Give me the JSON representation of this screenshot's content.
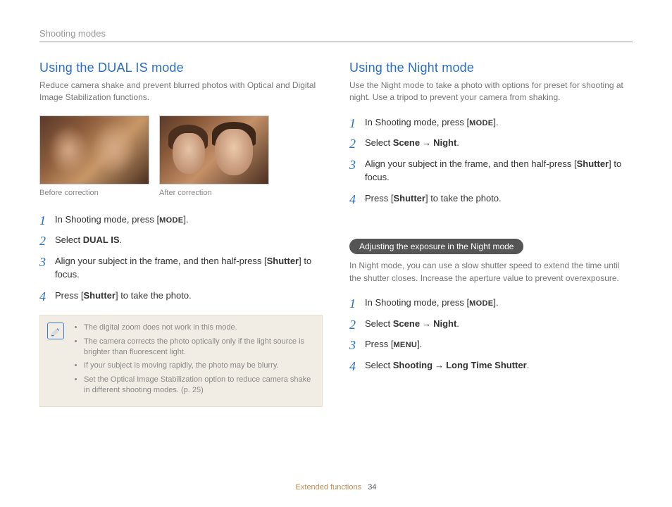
{
  "breadcrumb": "Shooting modes",
  "left": {
    "heading": "Using the DUAL IS mode",
    "intro": "Reduce camera shake and prevent blurred photos with Optical and Digital Image Stabilization functions.",
    "caption_before": "Before correction",
    "caption_after": "After correction",
    "step1_a": "In Shooting mode, press [",
    "step1_mode": "MODE",
    "step1_b": "].",
    "step2_a": "Select ",
    "step2_b": "DUAL IS",
    "step2_c": ".",
    "step3_a": "Align your subject in the frame, and then half-press [",
    "step3_shutter": "Shutter",
    "step3_b": "] to focus.",
    "step4_a": "Press [",
    "step4_shutter": "Shutter",
    "step4_b": "] to take the photo.",
    "notes": {
      "n1": "The digital zoom does not work in this mode.",
      "n2": "The camera corrects the photo optically only if the light source is brighter than fluorescent light.",
      "n3": "If your subject is moving rapidly, the photo may be blurry.",
      "n4": "Set the Optical Image Stabilization option to reduce camera shake in different shooting modes. (p. 25)"
    }
  },
  "right": {
    "heading": "Using the Night mode",
    "intro": "Use the Night mode to take a photo with options for preset for shooting at night. Use a tripod to prevent your camera from shaking.",
    "step1_a": "In Shooting mode, press [",
    "step1_mode": "MODE",
    "step1_b": "].",
    "step2_a": "Select ",
    "step2_scene": "Scene",
    "step2_arrow": "→",
    "step2_night": "Night",
    "step2_c": ".",
    "step3_a": "Align your subject in the frame, and then half-press [",
    "step3_shutter": "Shutter",
    "step3_b": "] to focus.",
    "step4_a": "Press [",
    "step4_shutter": "Shutter",
    "step4_b": "] to take the photo.",
    "sub_heading": "Adjusting the exposure in the Night mode",
    "sub_intro": "In Night mode, you can use a slow shutter speed to extend the time until the shutter closes. Increase the aperture value to prevent overexposure.",
    "s2_step1_a": "In Shooting mode, press [",
    "s2_step1_mode": "MODE",
    "s2_step1_b": "].",
    "s2_step2_a": "Select ",
    "s2_step2_scene": "Scene",
    "s2_step2_arrow": "→",
    "s2_step2_night": "Night",
    "s2_step2_c": ".",
    "s2_step3_a": "Press [",
    "s2_step3_menu": "MENU",
    "s2_step3_b": "].",
    "s2_step4_a": "Select ",
    "s2_step4_shooting": "Shooting",
    "s2_step4_arrow": "→",
    "s2_step4_lts": "Long Time Shutter",
    "s2_step4_c": "."
  },
  "footer": {
    "section": "Extended functions",
    "page": "34"
  }
}
